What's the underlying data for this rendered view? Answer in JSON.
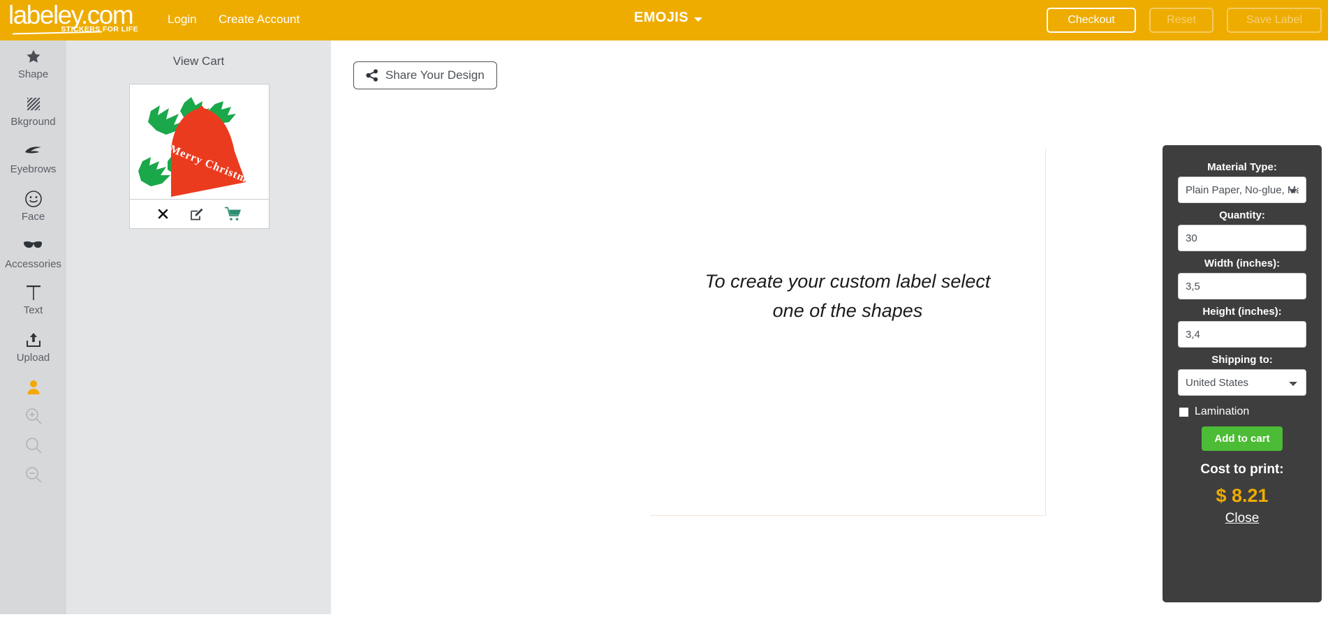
{
  "header": {
    "logo_text": "labeley.com",
    "logo_tagline": "STICKERS FOR LIFE",
    "login_label": "Login",
    "create_account_label": "Create Account",
    "category_title": "EMOJIS",
    "checkout_label": "Checkout",
    "reset_label": "Reset",
    "save_label": "Save Label",
    "bg_color": "#eeac00"
  },
  "sidebar": {
    "tools": [
      {
        "label": "Shape",
        "icon": "star-icon"
      },
      {
        "label": "Bkground",
        "icon": "hatch-square-icon"
      },
      {
        "label": "Eyebrows",
        "icon": "eyebrow-icon"
      },
      {
        "label": "Face",
        "icon": "smiley-face-icon"
      },
      {
        "label": "Accessories",
        "icon": "sunglasses-icon"
      },
      {
        "label": "Text",
        "icon": "text-t-icon"
      },
      {
        "label": "Upload",
        "icon": "upload-icon"
      }
    ],
    "zoom_tools": [
      {
        "icon": "person-icon",
        "active": true
      },
      {
        "icon": "zoom-in-icon",
        "active": false
      },
      {
        "icon": "zoom-reset-icon",
        "active": false
      },
      {
        "icon": "zoom-out-icon",
        "active": false
      }
    ],
    "active_color": "#f5a800"
  },
  "cart": {
    "view_cart_label": "View Cart",
    "thumbnail_alt": "Merry Christmas red bell with green holly label",
    "thumbnail_text": "Merry Christmas",
    "thumbnail_bell_color": "#eb3b1e",
    "thumbnail_holly_color": "#1aa84a",
    "actions": [
      {
        "name": "remove",
        "icon": "close-x-icon"
      },
      {
        "name": "edit",
        "icon": "edit-pencil-icon"
      },
      {
        "name": "add-again",
        "icon": "shopping-cart-icon"
      }
    ],
    "cart_icon_color": "#2d8d72"
  },
  "canvas": {
    "share_label": "Share Your Design",
    "share_icon": "share-nodes-icon",
    "hint_line_1": "To create your custom label select",
    "hint_line_2": "one of the shapes"
  },
  "options": {
    "material_label": "Material Type:",
    "material_value": "Plain Paper, No-glue, Matte",
    "material_options": [
      "Plain Paper, No-glue, Matte"
    ],
    "quantity_label": "Quantity:",
    "quantity_value": "30",
    "width_label": "Width (inches):",
    "width_value": "3,5",
    "height_label": "Height (inches):",
    "height_value": "3,4",
    "shipping_label": "Shipping to:",
    "shipping_value": "United States",
    "shipping_options": [
      "United States"
    ],
    "lamination_label": "Lamination",
    "lamination_checked": false,
    "add_to_cart_label": "Add to cart",
    "cost_label": "Cost to print:",
    "cost_value": "$ 8.21",
    "close_label": "Close",
    "panel_bg": "#3e3e3e",
    "accent_price_color": "#eeac00",
    "add_button_color": "#4cbb35"
  }
}
